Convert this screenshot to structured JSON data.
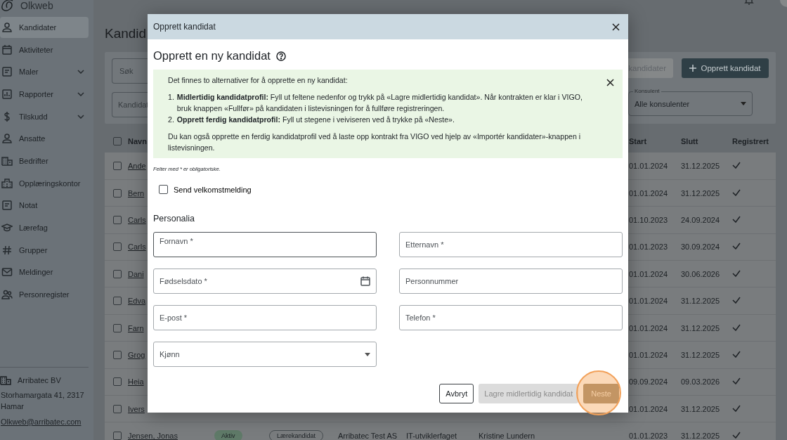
{
  "app": {
    "logo": "Olkweb"
  },
  "sidebar": {
    "items": [
      {
        "label": "Kandidater",
        "kind": "link",
        "selected": true
      },
      {
        "label": "Aktiviteter",
        "kind": "link",
        "selected": false
      },
      {
        "label": "Maler",
        "kind": "group",
        "selected": false
      },
      {
        "label": "Rapporter",
        "kind": "group",
        "selected": false
      },
      {
        "label": "Tilskudd",
        "kind": "group",
        "selected": false
      },
      {
        "label": "Ansatte",
        "kind": "link",
        "selected": false
      },
      {
        "label": "Bedrifter",
        "kind": "link",
        "selected": false
      },
      {
        "label": "Opplæringskontor",
        "kind": "link",
        "selected": false
      },
      {
        "label": "Notat",
        "kind": "link",
        "selected": false
      },
      {
        "label": "Lærefag",
        "kind": "link",
        "selected": false
      },
      {
        "label": "Grupper",
        "kind": "link",
        "selected": false
      },
      {
        "label": "Meldinger",
        "kind": "link",
        "selected": false
      },
      {
        "label": "Personregister",
        "kind": "link",
        "selected": false
      }
    ],
    "footer": {
      "company": "Arribatec BV",
      "address": "Storhamargata 41, 2317 Hamar",
      "email": "Olkweb@arribatec.com"
    }
  },
  "page": {
    "title": "Kandid",
    "search": {
      "placeholder": "Søk"
    },
    "filter": {
      "placeholder": "Kandidat"
    },
    "import_button": "kandidater",
    "create_button": "Opprett kandidat",
    "consultant_select": {
      "label": "Konsulent",
      "value": "Alle konsulenter"
    }
  },
  "table": {
    "header_checked": false,
    "columns": [
      "Navn",
      "Start",
      "Slutt",
      "Registrert"
    ],
    "rows": [
      {
        "name": "Ande",
        "start": "01.01.2024",
        "end": "31.12.2025",
        "registered": true,
        "checked": false
      },
      {
        "name": "Bern",
        "start": "01.01.2024",
        "end": "31.12.2025",
        "registered": true,
        "checked": false
      },
      {
        "name": "Carls",
        "start": "01.10.2023",
        "end": "24.09.2024",
        "registered": true,
        "checked": false
      },
      {
        "name": "Carls",
        "start": "01.01.2023",
        "end": "30.09.2024",
        "registered": true,
        "checked": false
      },
      {
        "name": "Dani",
        "start": "01.01.2024",
        "end": "30.06.2026",
        "registered": true,
        "checked": false
      },
      {
        "name": "Edva",
        "start": "01.01.2024",
        "end": "31.12.2025",
        "registered": true,
        "checked": false
      },
      {
        "name": "Farn",
        "start": "01.01.2024",
        "end": "31.12.2025",
        "registered": true,
        "checked": false
      },
      {
        "name": "Grog",
        "start": "01.01.2024",
        "end": "31.12.2025",
        "registered": true,
        "checked": false
      },
      {
        "name": "Heia",
        "start": "09.09.2024",
        "end": "09.03.2026",
        "registered": true,
        "checked": false
      },
      {
        "name": "Ivers",
        "start": "01.01.2024",
        "end": "31.12.2025",
        "registered": true,
        "checked": false
      },
      {
        "name": "Jensen, Jonas",
        "status": "Aktiv",
        "type": "Lærekandidat",
        "company": "Arribatec Test AS",
        "subject": "IT-utviklerfaget",
        "consultant": "Kristine Lundern",
        "start": "01.01.2023",
        "end": "31.12.2025",
        "registered": true,
        "checked": false
      }
    ]
  },
  "dialog": {
    "title": "Opprett kandidat",
    "heading": "Opprett en ny kandidat",
    "info": {
      "intro": "Det finnes to alternativer for å opprette en ny kandidat:",
      "steps": [
        {
          "number": "1.",
          "text": "**Midlertidig kandidatprofil:** Fyll ut feltene nedenfor og trykk på «Lagre midlertidig kandidat». Når kontrakten er klar i VIGO, bruk knappen «Fullfør» på kandidaten i listevisningen for å fullføre registreringen."
        },
        {
          "number": "2.",
          "text": "**Opprett ferdig kandidatprofil:** Fyll ut stegene i veiviseren ved å trykke på «Neste»."
        }
      ],
      "note": "Du kan også opprette en ferdig kandidatprofil ved å laste opp kontrakt fra VIGO ved hjelp av «Importér kandidater»-knappen i listevisningen."
    },
    "required_note": "Felter med * er obligatoriske.",
    "welcome_checkbox": {
      "label": "Send velkomstmelding",
      "checked": false
    },
    "section": "Personalia",
    "fields": [
      {
        "label": "Fornavn *",
        "kind": "text",
        "focused": true
      },
      {
        "label": "Etternavn *",
        "kind": "text",
        "focused": false
      },
      {
        "label": "Fødselsdato *",
        "kind": "date",
        "focused": false
      },
      {
        "label": "Personnummer",
        "kind": "text",
        "focused": false
      },
      {
        "label": "E-post *",
        "kind": "text",
        "focused": false
      },
      {
        "label": "Telefon *",
        "kind": "text",
        "focused": false
      },
      {
        "label": "Kjønn",
        "kind": "select",
        "focused": false
      }
    ],
    "buttons": [
      {
        "label": "Avbryt",
        "kind": "outline",
        "disabled": false,
        "highlighted": false
      },
      {
        "label": "Lagre midlertidig kandidat",
        "kind": "secondary",
        "disabled": true,
        "highlighted": false
      },
      {
        "label": "Neste",
        "kind": "primary",
        "disabled": false,
        "highlighted": true
      }
    ]
  }
}
